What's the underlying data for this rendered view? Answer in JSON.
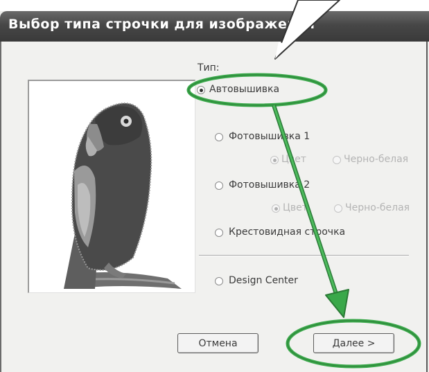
{
  "window": {
    "title": "Выбор типа строчки для изображения"
  },
  "type_group": {
    "label": "Тип:",
    "options": [
      {
        "label": "Автовышивка",
        "selected": true,
        "enabled": true
      },
      {
        "label": "Фотовышивка 1",
        "selected": false,
        "enabled": true
      },
      {
        "label": "Фотовышивка 2",
        "selected": false,
        "enabled": true
      },
      {
        "label": "Крестовидная строчка",
        "selected": false,
        "enabled": true
      },
      {
        "label": "Design Center",
        "selected": false,
        "enabled": true
      }
    ],
    "photo1_suboptions": [
      {
        "label": "Цвет",
        "selected": true,
        "enabled": false
      },
      {
        "label": "Черно-белая",
        "selected": false,
        "enabled": false
      }
    ],
    "photo2_suboptions": [
      {
        "label": "Цвет",
        "selected": true,
        "enabled": false
      },
      {
        "label": "Черно-белая",
        "selected": false,
        "enabled": false
      }
    ]
  },
  "buttons": {
    "cancel": "Отмена",
    "next": "Далее >"
  },
  "colors": {
    "title_bar": "#474747",
    "annotation": "#3aa84a",
    "dialog_bg": "#f1f1ef"
  },
  "icons": [
    "parrot-preview-image",
    "callout-pointer",
    "annotation-arrow"
  ]
}
